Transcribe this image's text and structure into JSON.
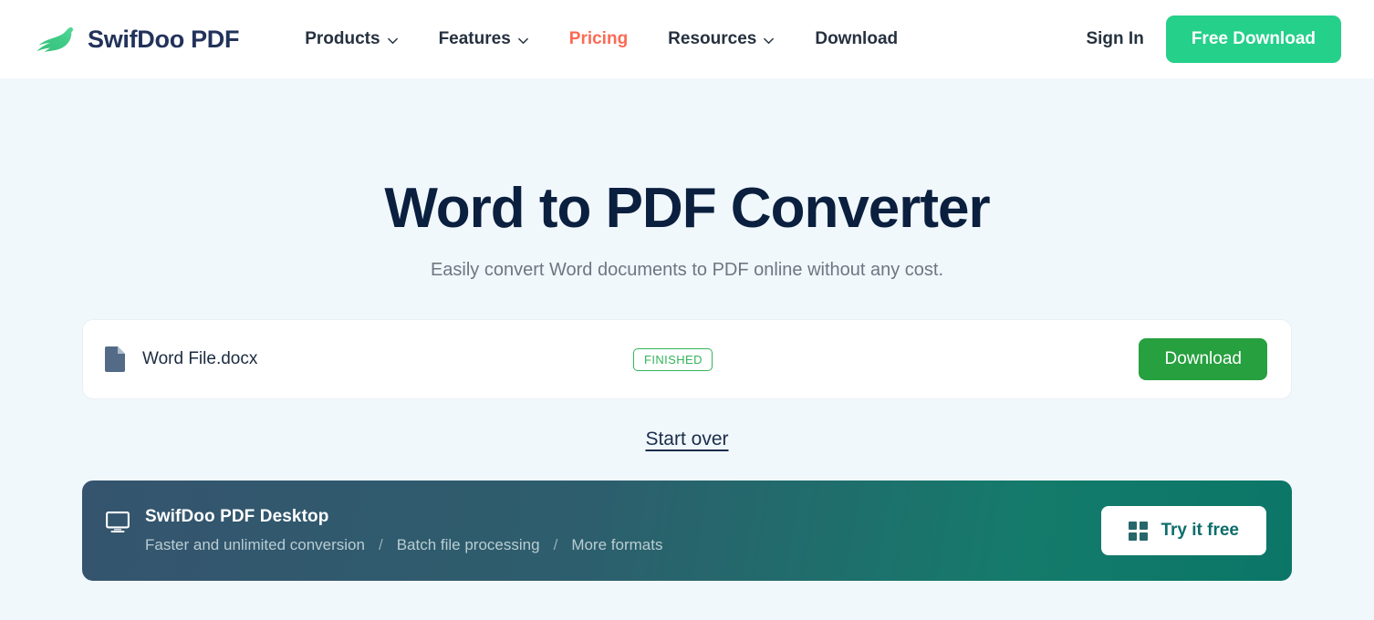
{
  "theme": {
    "page_bg": "#f1f8fc",
    "header_bg": "#ffffff",
    "title_color": "#0b1f3f",
    "accent_coral": "#fb6a55",
    "accent_green": "#25d08a",
    "download_green": "#27a03f",
    "badge_green": "#33b45a",
    "banner_gradient_from": "#35546e",
    "banner_gradient_to": "#0b7667"
  },
  "header": {
    "brand": {
      "name": "SwifDoo PDF",
      "logo_icon": "swallow-bird-logo"
    },
    "nav": [
      {
        "label": "Products",
        "has_dropdown": true,
        "active": false
      },
      {
        "label": "Features",
        "has_dropdown": true,
        "active": false
      },
      {
        "label": "Pricing",
        "has_dropdown": false,
        "active": true
      },
      {
        "label": "Resources",
        "has_dropdown": true,
        "active": false
      },
      {
        "label": "Download",
        "has_dropdown": false,
        "active": false
      }
    ],
    "sign_in_label": "Sign In",
    "free_download_label": "Free Download"
  },
  "hero": {
    "title": "Word to PDF Converter",
    "subtitle": "Easily convert Word documents to PDF online without any cost."
  },
  "file_row": {
    "icon": "document-icon",
    "name": "Word File.docx",
    "status": "FINISHED",
    "download_label": "Download"
  },
  "start_over_label": "Start over",
  "promo": {
    "icon": "monitor-icon",
    "title": "SwifDoo PDF Desktop",
    "features": [
      "Faster and unlimited conversion",
      "Batch file processing",
      "More formats"
    ],
    "separator": "/",
    "cta_label": "Try it free",
    "cta_icon": "windows-squares-icon"
  }
}
